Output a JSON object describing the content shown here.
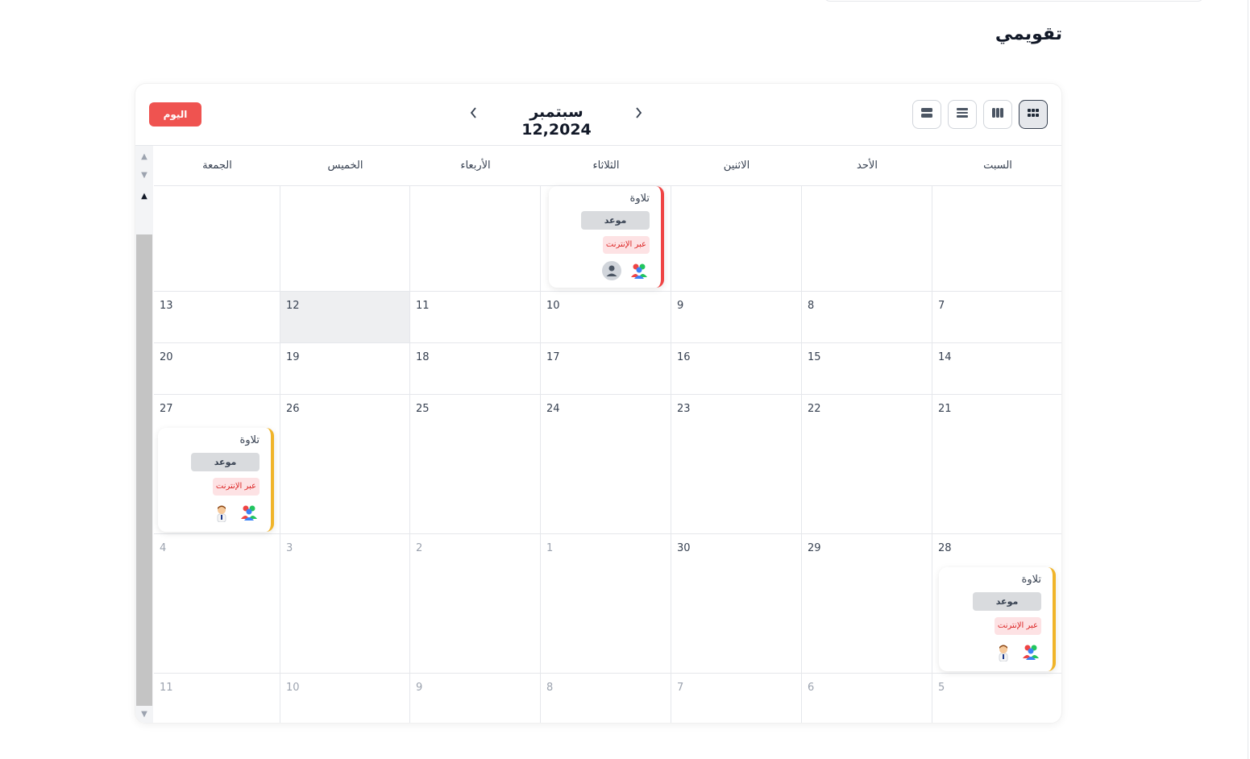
{
  "page": {
    "title": "تقويمي"
  },
  "toolbar": {
    "today_label": "اليوم",
    "month_label": "سبتمبر 12,2024",
    "prev_icon": "chevron-left-icon",
    "next_icon": "chevron-right-icon",
    "views": [
      {
        "name": "month-view",
        "icon": "grid-icon",
        "active": true
      },
      {
        "name": "week-view",
        "icon": "columns-icon",
        "active": false
      },
      {
        "name": "list-view",
        "icon": "list-icon",
        "active": false
      },
      {
        "name": "day-view",
        "icon": "rows-icon",
        "active": false
      }
    ]
  },
  "weekdays": [
    "السبت",
    "الأحد",
    "الاثنين",
    "الثلاثاء",
    "الأربعاء",
    "الخميس",
    "الجمعة"
  ],
  "weeks": [
    [
      {
        "num": "",
        "other": false
      },
      {
        "num": "",
        "other": false
      },
      {
        "num": "",
        "other": false
      },
      {
        "num": "",
        "other": false
      },
      {
        "num": "",
        "other": false
      },
      {
        "num": "",
        "other": false
      },
      {
        "num": "",
        "other": false
      }
    ],
    [
      {
        "num": "7"
      },
      {
        "num": "8"
      },
      {
        "num": "9"
      },
      {
        "num": "10"
      },
      {
        "num": "11"
      },
      {
        "num": "12",
        "today": true
      },
      {
        "num": "13"
      }
    ],
    [
      {
        "num": "14"
      },
      {
        "num": "15"
      },
      {
        "num": "16"
      },
      {
        "num": "17"
      },
      {
        "num": "18"
      },
      {
        "num": "19"
      },
      {
        "num": "20"
      }
    ],
    [
      {
        "num": "21"
      },
      {
        "num": "22"
      },
      {
        "num": "23"
      },
      {
        "num": "24"
      },
      {
        "num": "25"
      },
      {
        "num": "26"
      },
      {
        "num": "27"
      }
    ],
    [
      {
        "num": "28"
      },
      {
        "num": "29"
      },
      {
        "num": "30"
      },
      {
        "num": "1",
        "other": true
      },
      {
        "num": "2",
        "other": true
      },
      {
        "num": "3",
        "other": true
      },
      {
        "num": "4",
        "other": true
      }
    ],
    [
      {
        "num": "5",
        "other": true
      },
      {
        "num": "6",
        "other": true
      },
      {
        "num": "7",
        "other": true
      },
      {
        "num": "8",
        "other": true
      },
      {
        "num": "9",
        "other": true
      },
      {
        "num": "10",
        "other": true
      },
      {
        "num": "11",
        "other": true
      }
    ]
  ],
  "events": [
    {
      "title": "تلاوة",
      "type": "موعد",
      "mode": "عبر الإنترنت",
      "accent": "#ef4444",
      "icons": [
        "group-icon",
        "user-icon"
      ]
    },
    {
      "title": "تلاوة",
      "type": "موعد",
      "mode": "عبر الإنترنت",
      "accent": "#f0b429",
      "icons": [
        "group-icon",
        "teacher-avatar-icon"
      ]
    },
    {
      "title": "تلاوة",
      "type": "موعد",
      "mode": "عبر الإنترنت",
      "accent": "#f0b429",
      "icons": [
        "group-icon",
        "teacher-avatar-icon"
      ]
    }
  ],
  "colors": {
    "accent_red": "#ef5350",
    "today_bg": "#eeeff1",
    "scroll_thumb": "#c4c4c4"
  }
}
